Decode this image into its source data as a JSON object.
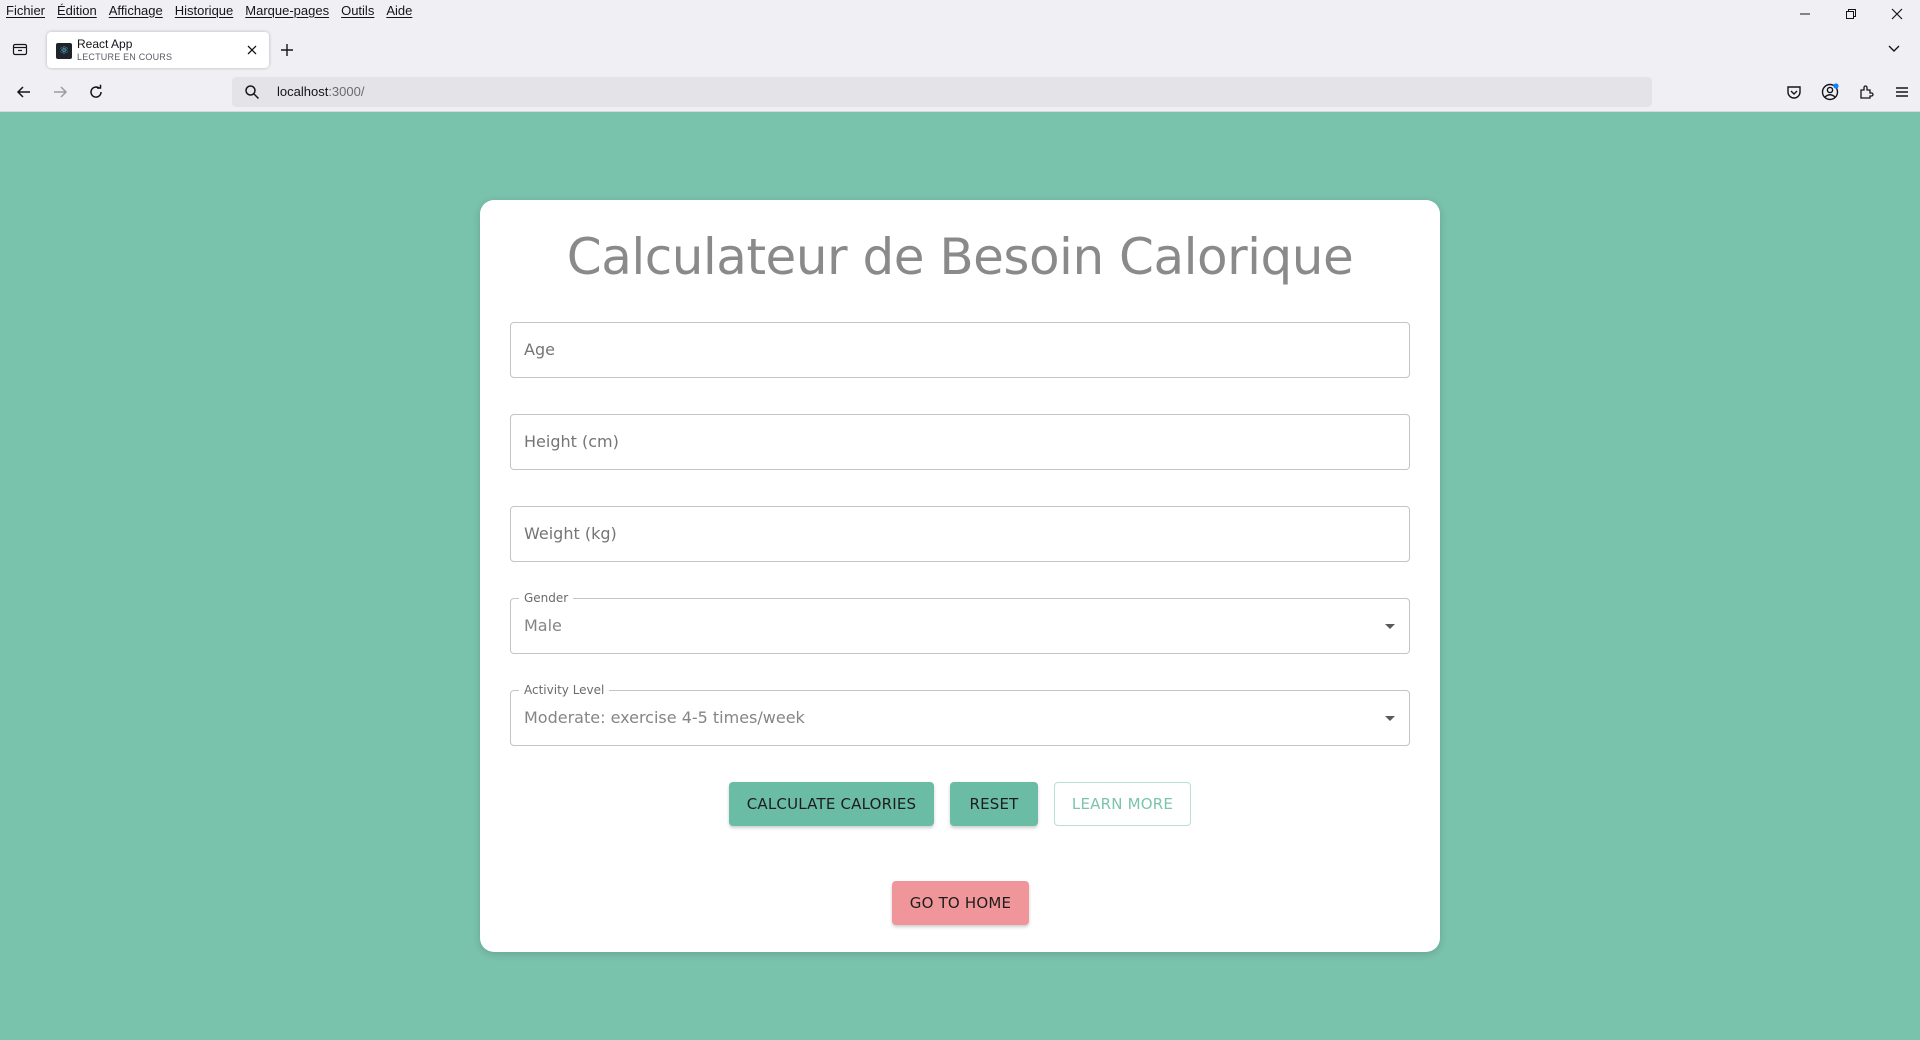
{
  "browser": {
    "menu": [
      "Fichier",
      "Édition",
      "Affichage",
      "Historique",
      "Marque-pages",
      "Outils",
      "Aide"
    ],
    "tab": {
      "title": "React App",
      "subtitle": "LECTURE EN COURS"
    },
    "url": {
      "host": "localhost",
      "rest": ":3000/"
    },
    "icons": [
      "back-icon",
      "forward-icon",
      "reload-icon",
      "search-icon",
      "pocket-icon",
      "account-icon",
      "extensions-icon",
      "menu-icon"
    ]
  },
  "page": {
    "title": "Calculateur de Besoin Calorique",
    "fields": {
      "age_placeholder": "Age",
      "height_placeholder": "Height (cm)",
      "weight_placeholder": "Weight (kg)",
      "gender_label": "Gender",
      "gender_value": "Male",
      "activity_label": "Activity Level",
      "activity_value": "Moderate: exercise 4-5 times/week"
    },
    "buttons": {
      "calculate": "CALCULATE CALORIES",
      "reset": "RESET",
      "learn_more": "LEARN MORE",
      "go_home": "GO TO HOME"
    },
    "colors": {
      "background": "#79c2ac",
      "primary_button": "#6bbca4",
      "home_button": "#f0959a"
    }
  }
}
